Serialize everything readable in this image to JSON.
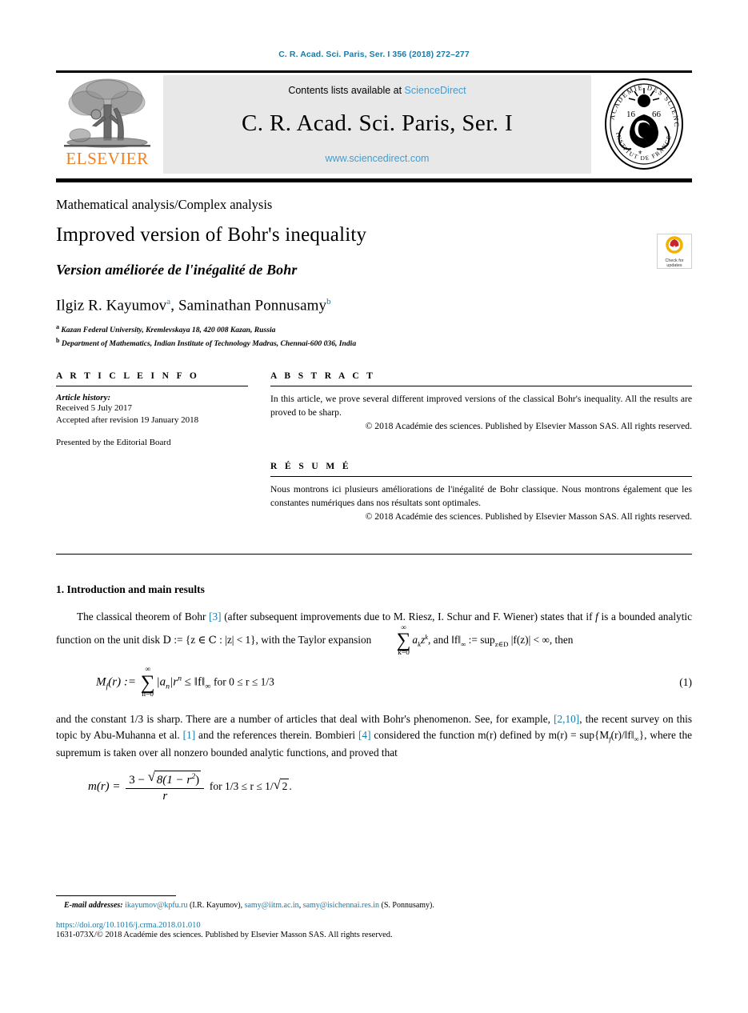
{
  "running_head": "C. R. Acad. Sci. Paris, Ser. I 356 (2018) 272–277",
  "banner": {
    "publisher_name": "ELSEVIER",
    "publisher_logo_icon": "elsevier-tree-logo",
    "contents_prefix": "Contents lists available at ",
    "contents_link": "ScienceDirect",
    "journal_title": "C. R. Acad. Sci. Paris, Ser. I",
    "sciencedirect_url": "www.sciencedirect.com",
    "seal_icon": "academie-des-sciences-seal",
    "seal_text_outer": "INSTITUT DE FRANCE",
    "seal_text_inner": "ACADEMIE DES SCIENCES",
    "seal_year": "1666",
    "link_color": "#3d9fd4",
    "elsevier_orange": "#f07f22"
  },
  "article": {
    "subject_area": "Mathematical analysis/Complex analysis",
    "title": "Improved version of Bohr's inequality",
    "title_fr": "Version améliorée de l'inégalité de Bohr",
    "authors": [
      {
        "name": "Ilgiz R. Kayumov",
        "mark": "a"
      },
      {
        "name": "Saminathan Ponnusamy",
        "mark": "b"
      }
    ],
    "authors_separator": ", ",
    "affiliations": [
      {
        "mark": "a",
        "text": "Kazan Federal University, Kremlevskaya 18, 420 008 Kazan, Russia"
      },
      {
        "mark": "b",
        "text": "Department of Mathematics, Indian Institute of Technology Madras, Chennai-600 036, India"
      }
    ],
    "crossmark": {
      "icon": "crossmark-check-for-updates-icon",
      "line1": "Check for",
      "line2": "updates"
    }
  },
  "info": {
    "heading": "A R T I C L E    I N F O",
    "history_label": "Article history:",
    "received": "Received 5 July 2017",
    "accepted": "Accepted after revision 19 January 2018",
    "presented_by": "Presented by the Editorial Board"
  },
  "abstract": {
    "heading": "A B S T R A C T",
    "text": "In this article, we prove several different improved versions of the classical Bohr's inequality. All the results are proved to be sharp.",
    "copyright": "© 2018 Académie des sciences. Published by Elsevier Masson SAS. All rights reserved."
  },
  "resume": {
    "heading": "R É S U M É",
    "text": "Nous montrons ici plusieurs améliorations de l'inégalité de Bohr classique. Nous montrons également que les constantes numériques dans nos résultats sont optimales.",
    "copyright": "© 2018 Académie des sciences. Published by Elsevier Masson SAS. All rights reserved."
  },
  "body": {
    "section_title": "1. Introduction and main results",
    "para1_a": "The classical theorem of Bohr ",
    "para1_ref": "[3]",
    "para1_b": " (after subsequent improvements due to M. Riesz, I. Schur and F. Wiener) states that if ",
    "para1_f": "f",
    "para1_c": " is a bounded analytic function on the unit disk ",
    "para1_disk": "D",
    "para1_d": " := {z ∈ ",
    "para1_cplx": "C",
    "para1_e": " : |z| < 1}, with the Taylor expansion ",
    "para1_taylor_sum": "∞",
    "para1_taylor_lim": "k=0",
    "para1_taylor_term": "a",
    "para1_taylor_sub": "k",
    "para1_taylor_z": "z",
    "para1_taylor_sup": "k",
    "para1_g": ", and ‖f‖",
    "para1_inf": "∞",
    "para1_h": " := sup",
    "para1_supsub": "z∈D",
    "para1_i": " |f(z)| < ∞, then",
    "eq1": {
      "lhs": "M",
      "lhs_sub": "f",
      "lhs_arg": "(r) :=",
      "sum_upper": "∞",
      "sum_lower": "n=0",
      "term": "|a",
      "term_sub": "n",
      "term_close": "|r",
      "term_sup": "n",
      "rel": "≤ ‖f‖",
      "rel_sub": "∞",
      "cond": "for 0 ≤ r ≤ 1/3",
      "number": "(1)"
    },
    "para2_a": "and the constant 1/3 is sharp. There are a number of articles that deal with Bohr's phenomenon. See, for example, ",
    "para2_ref1": "[2,10]",
    "para2_b": ", the recent survey on this topic by Abu-Muhanna et al. ",
    "para2_ref2": "[1]",
    "para2_c": " and the references therein. Bombieri ",
    "para2_ref3": "[4]",
    "para2_d": " considered the function m(r) defined by m(r) = sup{M",
    "para2_sub": "f",
    "para2_e": "(r)/‖f‖",
    "para2_sub2": "∞",
    "para2_f": "}, where the supremum is taken over all nonzero bounded analytic functions, and proved that",
    "eq2": {
      "lhs": "m(r) =",
      "num_lead": "3 −",
      "num_radicand": "8(1 − r",
      "num_radicand_sup": "2",
      "num_radicand_close": ")",
      "den": "r",
      "cond": "for 1/3 ≤ r ≤ 1/",
      "cond_sqrt": "2",
      "cond_end": "."
    }
  },
  "footer": {
    "email_label": "E-mail addresses:",
    "emails": [
      {
        "address": "ikayumov@kpfu.ru",
        "owner": " (I.R. Kayumov), "
      },
      {
        "address": "samy@iitm.ac.in",
        "owner": ", "
      },
      {
        "address": "samy@isichennai.res.in",
        "owner": " (S. Ponnusamy)."
      }
    ],
    "doi": "https://doi.org/10.1016/j.crma.2018.01.010",
    "issn_copyright": "1631-073X/© 2018 Académie des sciences. Published by Elsevier Masson SAS. All rights reserved."
  }
}
